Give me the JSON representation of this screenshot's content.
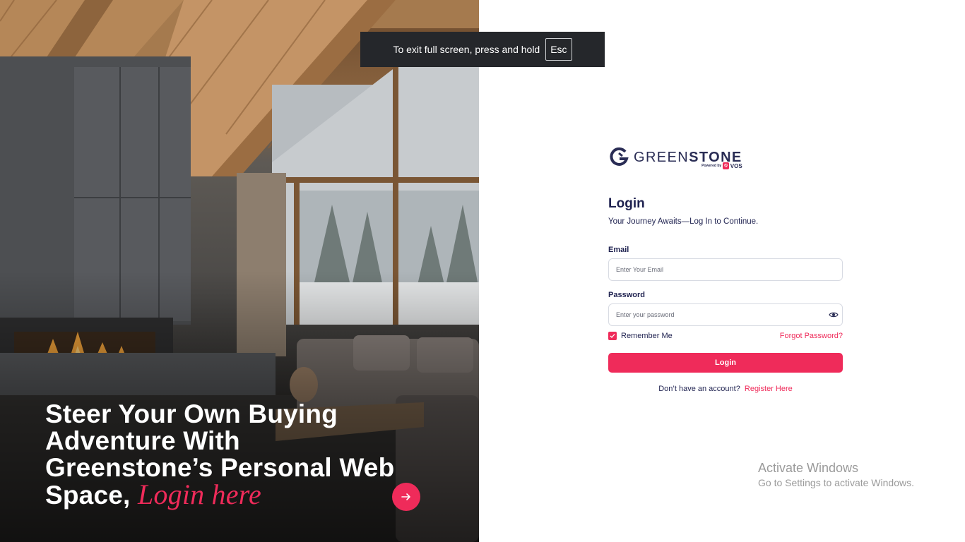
{
  "hero": {
    "headline_main": "Steer Your Own Buying Adventure With Greenstone’s Personal Web Space,",
    "headline_accent": "Login here",
    "arrow_icon": "arrow-right-icon",
    "accent_color": "#ef2b5a"
  },
  "fullscreen_toast": {
    "message": "To exit full screen, press and hold",
    "key": "Esc"
  },
  "brand": {
    "word_thin": "GREEN",
    "word_bold": "STONE",
    "powered_by": "Powered by",
    "vos": "VOS",
    "logo_icon": "greenstone-logo-icon"
  },
  "login": {
    "title": "Login",
    "subtitle": "Your Journey Awaits—Log In to Continue.",
    "email_label": "Email",
    "email_placeholder": "Enter Your Email",
    "email_value": "",
    "password_label": "Password",
    "password_placeholder": "Enter your password",
    "password_value": "",
    "remember_label": "Remember Me",
    "remember_checked": true,
    "forgot_label": "Forgot Password?",
    "submit_label": "Login",
    "no_account_text": "Don’t have an account?",
    "register_label": "Register Here"
  },
  "watermark": {
    "title": "Activate Windows",
    "subtitle": "Go to Settings to activate Windows."
  },
  "colors": {
    "brand_navy": "#1f2250",
    "brand_pink": "#ef2b5a"
  }
}
